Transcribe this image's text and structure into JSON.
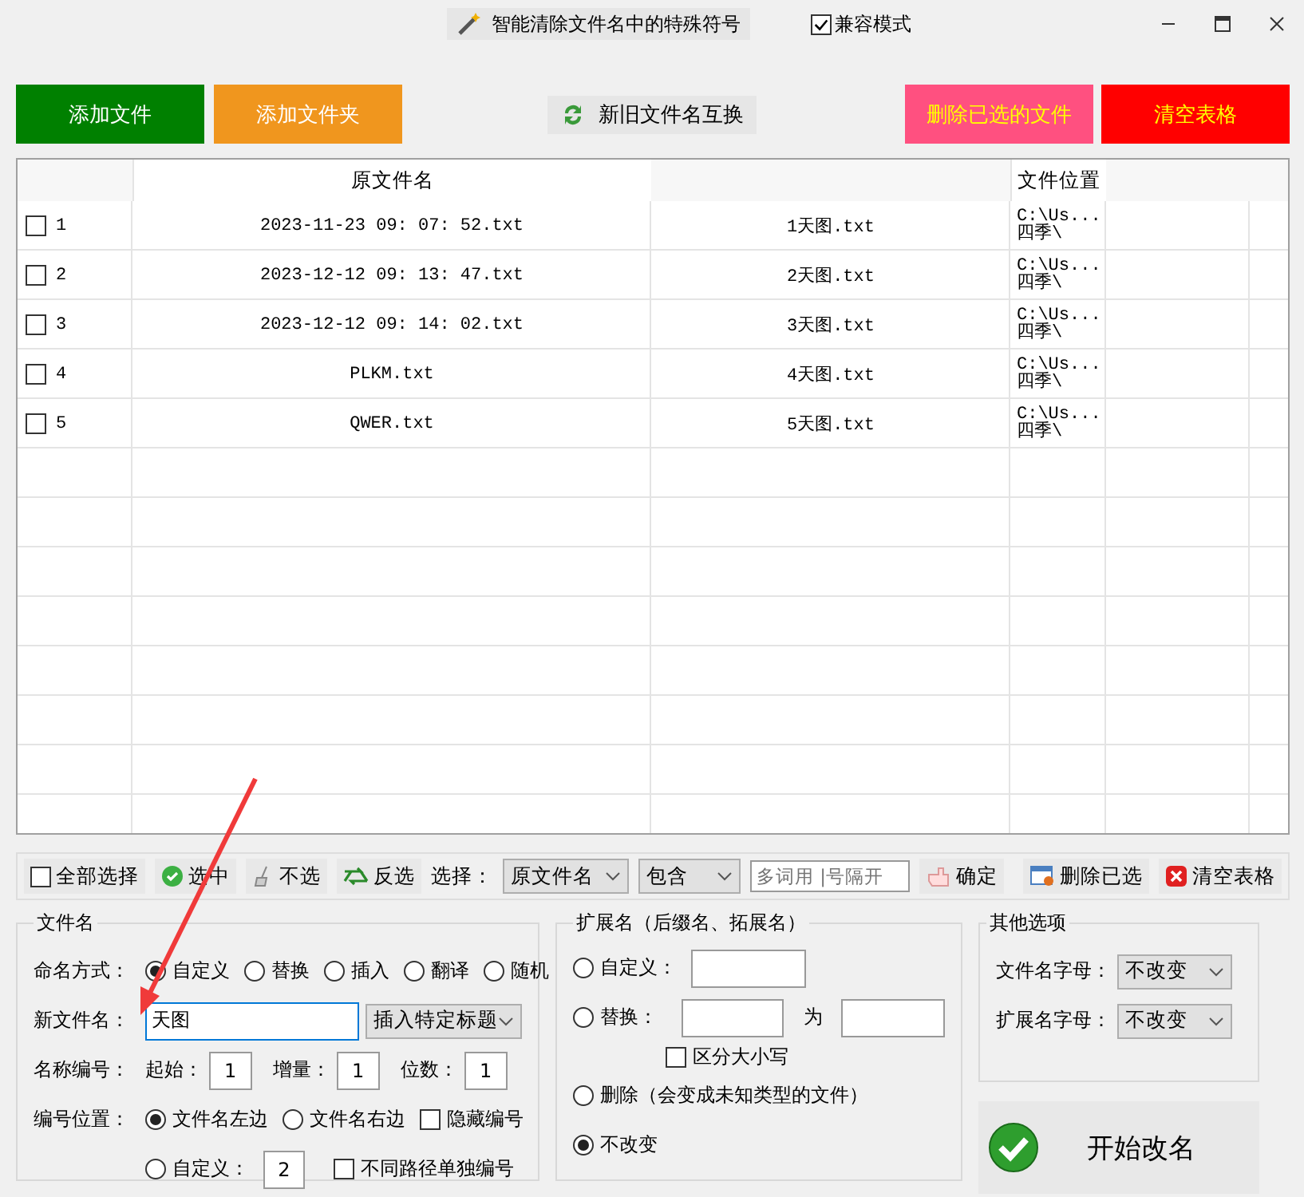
{
  "title_bar": {
    "action_button": "智能清除文件名中的特殊符号",
    "compat_mode": {
      "label": "兼容模式",
      "checked": true
    }
  },
  "top_buttons": [
    {
      "label": "添加文件",
      "color": "#008000",
      "kind": "filled"
    },
    {
      "label": "添加文件夹",
      "color": "#f0961e",
      "kind": "filled"
    },
    {
      "label": "新旧文件名互换",
      "kind": "swap"
    },
    {
      "label": "删除已选的文件",
      "color": "#ff5080",
      "kind": "warning"
    },
    {
      "label": "清空表格",
      "color": "#ff0000",
      "kind": "warning"
    }
  ],
  "table": {
    "column_2": "原文件名",
    "column_4": "文件位置",
    "rows": [
      {
        "checked": false,
        "number": "1",
        "original": "2023-11-23 09: 07: 52.txt",
        "new_name": "1天图.txt",
        "location": "C:\\Us...",
        "location_line_2": "四季\\"
      },
      {
        "checked": false,
        "number": "2",
        "original": "2023-12-12 09: 13: 47.txt",
        "new_name": "2天图.txt",
        "location": "C:\\Us...",
        "location_line_2": "四季\\"
      },
      {
        "checked": false,
        "number": "3",
        "original": "2023-12-12 09: 14: 02.txt",
        "new_name": "3天图.txt",
        "location": "C:\\Us...",
        "location_line_2": "四季\\"
      },
      {
        "checked": false,
        "number": "4",
        "original": "PLKM.txt",
        "new_name": "4天图.txt",
        "location": "C:\\Us...",
        "location_line_2": "四季\\"
      },
      {
        "checked": false,
        "number": "5",
        "original": "QWER.txt",
        "new_name": "5天图.txt",
        "location": "C:\\Us...",
        "location_line_2": "四季\\"
      }
    ]
  },
  "toolbar": {
    "select_all": {
      "label": "全部选择",
      "checked": false
    },
    "buttons": [
      {
        "label": "选中",
        "kind": "check"
      },
      {
        "label": "不选",
        "kind": "clear"
      },
      {
        "label": "反选",
        "kind": "invert"
      }
    ],
    "filter_label": "选择：",
    "field_dropdown": "原文件名",
    "match_dropdown": "包含",
    "keywords": {
      "placeholder": "多词用 |号隔开"
    },
    "confirm_button": "确定",
    "right_buttons": [
      {
        "label": "删除已选",
        "kind": "delete"
      },
      {
        "label": "清空表格",
        "kind": "clear_all"
      }
    ]
  },
  "filename_group": {
    "title": "文件名",
    "naming_mode": {
      "label": "命名方式：",
      "options": [
        {
          "label": "自定义",
          "selected": true
        },
        {
          "label": "替换",
          "selected": false
        },
        {
          "label": "插入",
          "selected": false
        },
        {
          "label": "翻译",
          "selected": false
        },
        {
          "label": "随机",
          "selected": false
        }
      ]
    },
    "new_name": {
      "label": "新文件名：",
      "value": "天图",
      "dropdown": "插入特定标题"
    },
    "numbering": {
      "label": "名称编号：",
      "fields": [
        {
          "label": "起始：",
          "value": "1"
        },
        {
          "label": "增量：",
          "value": "1"
        },
        {
          "label": "位数：",
          "value": "1"
        }
      ]
    },
    "position": {
      "label": "编号位置：",
      "options": [
        {
          "label": "文件名左边",
          "selected": true
        },
        {
          "label": "文件名右边",
          "selected": false
        },
        {
          "label": "自定义：",
          "selected": false,
          "value": "2"
        }
      ],
      "hide_number": {
        "label": "隐藏编号",
        "checked": false
      },
      "separate_paths": {
        "label": "不同路径单独编号",
        "checked": false
      }
    }
  },
  "extension_group": {
    "title": "扩展名（后缀名、拓展名）",
    "options": [
      {
        "kind": "custom",
        "label": "自定义：",
        "selected": false
      },
      {
        "kind": "replace",
        "label": "替换：",
        "selected": false,
        "joiner": "为",
        "case_sensitive": {
          "label": "区分大小写",
          "checked": false
        }
      },
      {
        "kind": "plain",
        "label": "删除（会变成未知类型的文件）",
        "selected": false
      },
      {
        "kind": "plain",
        "label": "不改变",
        "selected": true
      }
    ]
  },
  "other_group": {
    "title": "其他选项",
    "fields": [
      {
        "label": "文件名字母：",
        "value": "不改变"
      },
      {
        "label": "扩展名字母：",
        "value": "不改变"
      }
    ]
  },
  "start_button": "开始改名"
}
